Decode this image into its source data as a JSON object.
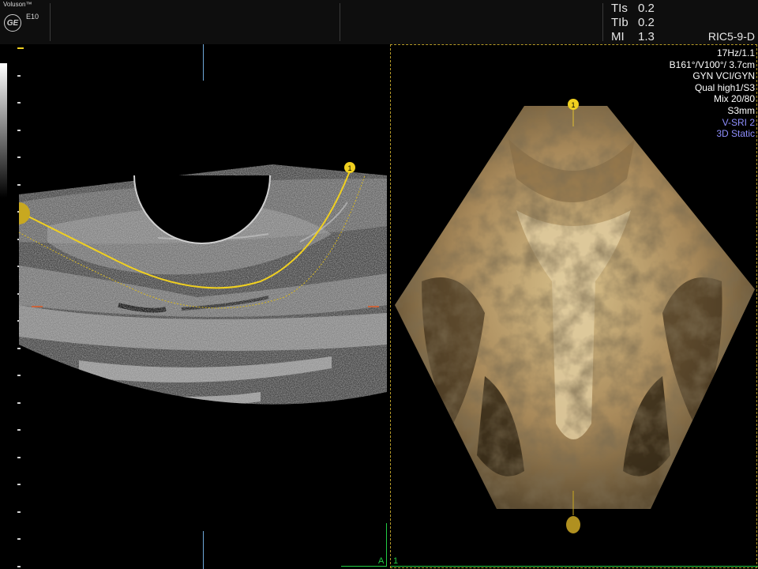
{
  "header": {
    "brand": "Voluson™",
    "logo_text": "GE",
    "model": "E10",
    "safety": [
      {
        "label": "TIs",
        "value": "0.2"
      },
      {
        "label": "TIb",
        "value": "0.2"
      },
      {
        "label": "MI",
        "value": "1.3"
      }
    ],
    "probe": "RIC5-9-D"
  },
  "params": {
    "frame_rate": "17Hz/1.1",
    "angles": "B161°/V100°/ 3.7cm",
    "preset": "GYN VCI/GYN",
    "quality": "Qual high1/S3",
    "mix": "Mix 20/80",
    "slice": "S3mm",
    "vsri": "V-SRI 2",
    "mode": "3D Static"
  },
  "bmode": {
    "curve_marker_label": "1"
  },
  "render": {
    "top_marker_label": "1"
  },
  "footer": {
    "label_a": "A",
    "label_1": "1"
  },
  "colors": {
    "curve": "#f0d020",
    "sepia": "#b49a60",
    "accent_blue": "#8f8fff",
    "marker_blue": "#6fa8d8",
    "orient": "#c8643c",
    "frame_green": "#22cc44"
  },
  "icons": {
    "logo": "ge-logo-icon",
    "curve_end": "yellow-circle-icon",
    "curve_start": "yellow-half-disc-icon",
    "render_bottom": "render-bottom-disc-icon"
  }
}
